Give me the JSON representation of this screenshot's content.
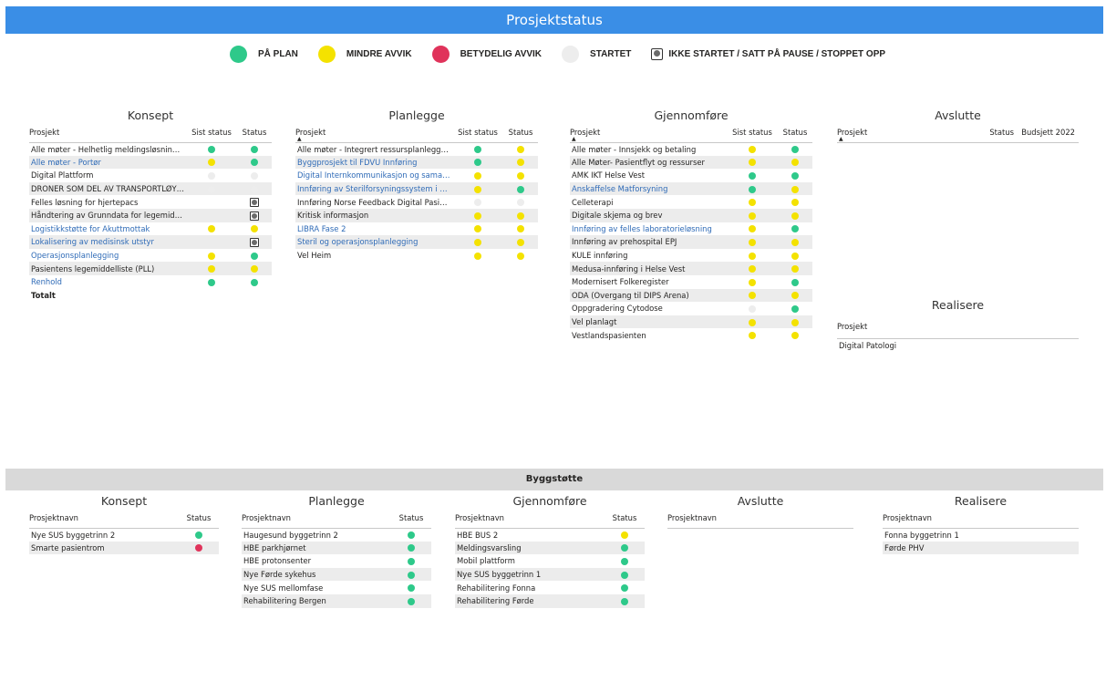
{
  "title": "Prosjektstatus",
  "colors": {
    "green": "#2ec98a",
    "yellow": "#f4e200",
    "red": "#e0335b",
    "light": "#ededed",
    "header_bg": "#3a8ee6"
  },
  "legend": [
    {
      "icon": "green",
      "label": "PÅ PLAN"
    },
    {
      "icon": "yellow",
      "label": "MINDRE AVVIK"
    },
    {
      "icon": "red",
      "label": "BETYDELIG AVVIK"
    },
    {
      "icon": "light",
      "label": "STARTET"
    },
    {
      "icon": "paused",
      "label": "IKKE STARTET / SATT PÅ PAUSE / STOPPET OPP"
    }
  ],
  "top": {
    "konsept": {
      "title": "Konsept",
      "headers": {
        "prosjekt": "Prosjekt",
        "sist": "Sist status",
        "status": "Status"
      },
      "rows": [
        {
          "name": "Alle møter - Helhetlig meldingsløsning og...",
          "link": false,
          "sist": "green",
          "status": "green"
        },
        {
          "name": "Alle møter - Portør",
          "link": true,
          "sist": "yellow",
          "status": "green"
        },
        {
          "name": "Digital Plattform",
          "link": false,
          "sist": "light",
          "status": "light"
        },
        {
          "name": "DRONER SOM DEL AV TRANSPORTLØYSING",
          "link": false,
          "sist": "light",
          "status": "light"
        },
        {
          "name": "Felles løsning for hjertepacs",
          "link": false,
          "sist": "",
          "status": "paused"
        },
        {
          "name": "Håndtering av Grunndata for legemiddel",
          "link": false,
          "sist": "",
          "status": "paused"
        },
        {
          "name": "Logistikkstøtte for Akuttmottak",
          "link": true,
          "sist": "yellow",
          "status": "yellow"
        },
        {
          "name": "Lokalisering av medisinsk utstyr",
          "link": true,
          "sist": "",
          "status": "paused"
        },
        {
          "name": "Operasjonsplanlegging",
          "link": true,
          "sist": "yellow",
          "status": "green"
        },
        {
          "name": "Pasientens legemiddelliste (PLL)",
          "link": false,
          "sist": "yellow",
          "status": "yellow"
        },
        {
          "name": "Renhold",
          "link": true,
          "sist": "green",
          "status": "green"
        }
      ],
      "total": "Totalt"
    },
    "planlegge": {
      "title": "Planlegge",
      "headers": {
        "prosjekt": "Prosjekt",
        "sist": "Sist status",
        "status": "Status"
      },
      "rows": [
        {
          "name": "Alle møter - Integrert ressursplanlegging",
          "link": false,
          "sist": "green",
          "status": "yellow"
        },
        {
          "name": "Byggprosjekt til FDVU Innføring",
          "link": true,
          "sist": "green",
          "status": "yellow"
        },
        {
          "name": "Digital Internkommunikasjon og samarbeid",
          "link": true,
          "sist": "yellow",
          "status": "yellow"
        },
        {
          "name": "Innføring av Sterilforsyningssystem i Helse Vest",
          "link": true,
          "sist": "yellow",
          "status": "green"
        },
        {
          "name": "Innføring Norse Feedback Digital Pasientrapportering",
          "link": false,
          "sist": "light",
          "status": "light"
        },
        {
          "name": "Kritisk informasjon",
          "link": false,
          "sist": "yellow",
          "status": "yellow"
        },
        {
          "name": "LIBRA Fase 2",
          "link": true,
          "sist": "yellow",
          "status": "yellow"
        },
        {
          "name": "Steril og operasjonsplanlegging",
          "link": true,
          "sist": "yellow",
          "status": "yellow"
        },
        {
          "name": "Vel Heim",
          "link": false,
          "sist": "yellow",
          "status": "yellow"
        }
      ]
    },
    "gjennomfore": {
      "title": "Gjennomføre",
      "headers": {
        "prosjekt": "Prosjekt",
        "sist": "Sist status",
        "status": "Status"
      },
      "rows": [
        {
          "name": "Alle møter - Innsjekk og betaling",
          "link": false,
          "sist": "yellow",
          "status": "green"
        },
        {
          "name": "Alle Møter- Pasientflyt og ressurser",
          "link": false,
          "sist": "yellow",
          "status": "yellow"
        },
        {
          "name": "AMK IKT Helse Vest",
          "link": false,
          "sist": "green",
          "status": "green"
        },
        {
          "name": "Anskaffelse Matforsyning",
          "link": true,
          "sist": "green",
          "status": "yellow"
        },
        {
          "name": "Celleterapi",
          "link": false,
          "sist": "yellow",
          "status": "yellow"
        },
        {
          "name": "Digitale skjema og brev",
          "link": false,
          "sist": "yellow",
          "status": "yellow"
        },
        {
          "name": "Innføring av felles laboratorieløsning",
          "link": true,
          "sist": "yellow",
          "status": "green"
        },
        {
          "name": "Innføring av prehospital EPJ",
          "link": false,
          "sist": "yellow",
          "status": "yellow"
        },
        {
          "name": "KULE innføring",
          "link": false,
          "sist": "yellow",
          "status": "yellow"
        },
        {
          "name": "Medusa-innføring i Helse Vest",
          "link": false,
          "sist": "yellow",
          "status": "yellow"
        },
        {
          "name": "Modernisert Folkeregister",
          "link": false,
          "sist": "yellow",
          "status": "green"
        },
        {
          "name": "ODA (Overgang til DIPS Arena)",
          "link": false,
          "sist": "yellow",
          "status": "yellow"
        },
        {
          "name": "Oppgradering Cytodose",
          "link": false,
          "sist": "light",
          "status": "green"
        },
        {
          "name": "Vel planlagt",
          "link": false,
          "sist": "yellow",
          "status": "yellow"
        },
        {
          "name": "Vestlandspasienten",
          "link": false,
          "sist": "yellow",
          "status": "yellow"
        }
      ]
    },
    "avslutte": {
      "title": "Avslutte",
      "headers": {
        "prosjekt": "Prosjekt",
        "status": "Status",
        "budsjett": "Budsjett 2022"
      }
    },
    "realisere": {
      "title": "Realisere",
      "headers": {
        "prosjekt": "Prosjekt"
      },
      "rows": [
        {
          "name": "Digital Patologi"
        }
      ]
    }
  },
  "bygg": {
    "title": "Byggstøtte",
    "konsept": {
      "title": "Konsept",
      "headers": {
        "prosjekt": "Prosjektnavn",
        "status": "Status"
      },
      "rows": [
        {
          "name": "Nye SUS byggetrinn 2",
          "status": "green"
        },
        {
          "name": "Smarte pasientrom",
          "status": "red"
        }
      ]
    },
    "planlegge": {
      "title": "Planlegge",
      "headers": {
        "prosjekt": "Prosjektnavn",
        "status": "Status"
      },
      "rows": [
        {
          "name": "Haugesund byggetrinn 2",
          "status": "green"
        },
        {
          "name": "HBE parkhjørnet",
          "status": "green"
        },
        {
          "name": "HBE protonsenter",
          "status": "green"
        },
        {
          "name": "Nye Førde sykehus",
          "status": "green"
        },
        {
          "name": "Nye SUS mellomfase",
          "status": "green"
        },
        {
          "name": "Rehabilitering Bergen",
          "status": "green"
        }
      ]
    },
    "gjennomfore": {
      "title": "Gjennomføre",
      "headers": {
        "prosjekt": "Prosjektnavn",
        "status": "Status"
      },
      "rows": [
        {
          "name": "HBE BUS 2",
          "status": "yellow"
        },
        {
          "name": "Meldingsvarsling",
          "status": "green"
        },
        {
          "name": "Mobil plattform",
          "status": "green"
        },
        {
          "name": "Nye SUS byggetrinn 1",
          "status": "green"
        },
        {
          "name": "Rehabilitering Fonna",
          "status": "green"
        },
        {
          "name": "Rehabilitering Førde",
          "status": "green"
        }
      ]
    },
    "avslutte": {
      "title": "Avslutte",
      "headers": {
        "prosjekt": "Prosjektnavn"
      }
    },
    "realisere": {
      "title": "Realisere",
      "headers": {
        "prosjekt": "Prosjektnavn"
      },
      "rows": [
        {
          "name": "Fonna byggetrinn 1"
        },
        {
          "name": "Førde PHV"
        }
      ]
    }
  }
}
